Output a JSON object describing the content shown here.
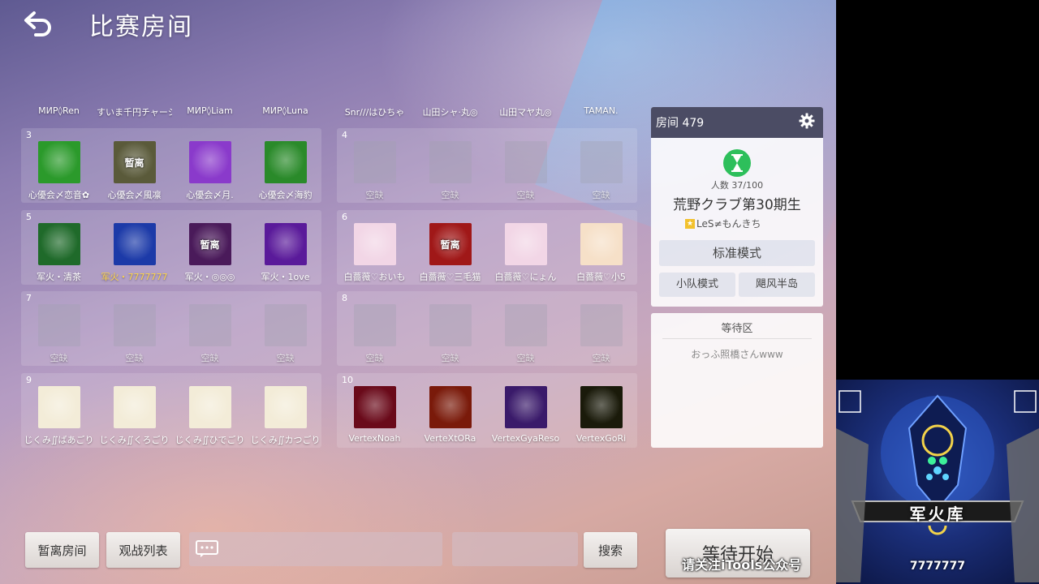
{
  "page": {
    "title": "比赛房间"
  },
  "top_names": [
    "МИР◊Ren",
    "すいま千円チャーシュ",
    "МИР◊Liam",
    "МИР◊Luna",
    "Snr///はひちゃ",
    "山田シャ·丸◎",
    "山田マヤ丸◎",
    "TAMAN."
  ],
  "teams": [
    {
      "num": "3",
      "slots": [
        {
          "name": "心優会〆恋音✿",
          "type": "avatar",
          "color": "#2b9a2b",
          "label": ""
        },
        {
          "name": "心優会〆風凛",
          "type": "avatar",
          "color": "#5a5a3a",
          "label": "暂离"
        },
        {
          "name": "心優会〆月.",
          "type": "avatar",
          "color": "#8a3acb",
          "label": ""
        },
        {
          "name": "心優会〆海豹",
          "type": "avatar",
          "color": "#2a8a2a",
          "label": ""
        }
      ]
    },
    {
      "num": "4",
      "slots": [
        {
          "name": "空缺",
          "type": "empty"
        },
        {
          "name": "空缺",
          "type": "empty"
        },
        {
          "name": "空缺",
          "type": "empty"
        },
        {
          "name": "空缺",
          "type": "empty"
        }
      ]
    },
    {
      "num": "5",
      "slots": [
        {
          "name": "军火・清茶",
          "type": "avatar",
          "color": "#1f6a2a",
          "label": ""
        },
        {
          "name": "军火・7777777",
          "type": "avatar",
          "color": "#1c3aa8",
          "label": "",
          "gold": true
        },
        {
          "name": "军火・◎◎◎",
          "type": "avatar",
          "color": "#4a1a5a",
          "label": "暂离"
        },
        {
          "name": "军火・1ove",
          "type": "avatar",
          "color": "#5a1a9a",
          "label": ""
        }
      ]
    },
    {
      "num": "6",
      "slots": [
        {
          "name": "白薔薇♡おいも",
          "type": "avatar",
          "color": "#f2d6e6",
          "label": ""
        },
        {
          "name": "白薔薇♡三毛猫",
          "type": "avatar",
          "color": "#a01818",
          "label": "暂离"
        },
        {
          "name": "白薔薇♡にょん",
          "type": "avatar",
          "color": "#f2d6e6",
          "label": ""
        },
        {
          "name": "白薔薇♡小5",
          "type": "avatar",
          "color": "#f6e0c8",
          "label": ""
        }
      ]
    },
    {
      "num": "7",
      "slots": [
        {
          "name": "空缺",
          "type": "empty"
        },
        {
          "name": "空缺",
          "type": "empty"
        },
        {
          "name": "空缺",
          "type": "empty"
        },
        {
          "name": "空缺",
          "type": "empty"
        }
      ]
    },
    {
      "num": "8",
      "slots": [
        {
          "name": "空缺",
          "type": "empty"
        },
        {
          "name": "空缺",
          "type": "empty"
        },
        {
          "name": "空缺",
          "type": "empty"
        },
        {
          "name": "空缺",
          "type": "empty"
        }
      ]
    },
    {
      "num": "9",
      "slots": [
        {
          "name": "じくみ∬ばあごり",
          "type": "avatar",
          "color": "#f3ecd8",
          "label": ""
        },
        {
          "name": "じくみ∬くろごり",
          "type": "avatar",
          "color": "#f3ecd8",
          "label": ""
        },
        {
          "name": "じくみ∬ひでごり",
          "type": "avatar",
          "color": "#f3ecd8",
          "label": ""
        },
        {
          "name": "じくみ∬カつごり",
          "type": "avatar",
          "color": "#f3ecd8",
          "label": ""
        }
      ]
    },
    {
      "num": "10",
      "slots": [
        {
          "name": "VertexNoah",
          "type": "avatar",
          "color": "#6a0a1a",
          "label": ""
        },
        {
          "name": "VerteXtORa",
          "type": "avatar",
          "color": "#7a1a0a",
          "label": ""
        },
        {
          "name": "VertexGyaReso",
          "type": "avatar",
          "color": "#3a1a6a",
          "label": ""
        },
        {
          "name": "VertexGoRi",
          "type": "avatar",
          "color": "#1a1a0a",
          "label": ""
        }
      ]
    }
  ],
  "room": {
    "header": "房间 479",
    "count": "人数 37/100",
    "name": "荒野クラブ第30期生",
    "host": "LeS≠もんきち",
    "mode_main": "标准模式",
    "mode_team": "小队模式",
    "mode_map": "飓风半岛"
  },
  "waiting": {
    "title": "等待区",
    "items": [
      "おっふ照橋さんwww"
    ]
  },
  "bottom": {
    "away_button": "暂离房间",
    "spectate_button": "观战列表",
    "search_button": "搜索",
    "start_button": "等待开始",
    "watermark": "请关注iTools公众号"
  },
  "overlay": {
    "banner": "军火库",
    "number": "7777777"
  },
  "colors": {
    "room_header": "#4b4c64",
    "hourglass": "#2dbf5b",
    "gold_name": "#ffd54a"
  }
}
